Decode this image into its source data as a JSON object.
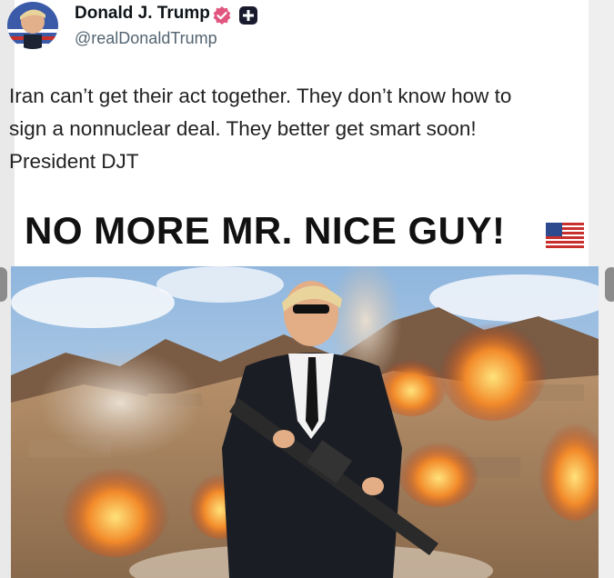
{
  "author": {
    "name": "Donald J. Trump",
    "handle": "@realDonaldTrump",
    "verified_color": "#e0567e"
  },
  "post": {
    "text": "Iran can’t get their act together. They don’t know how to\nsign a nonnuclear deal. They better get smart soon!\nPresident DJT"
  },
  "image": {
    "headline": "NO MORE MR. NICE GUY!",
    "flag_icon": "us-flag-icon"
  },
  "carousel": {
    "prev_icon": "chevron-left-icon",
    "next_icon": "chevron-right-icon"
  }
}
